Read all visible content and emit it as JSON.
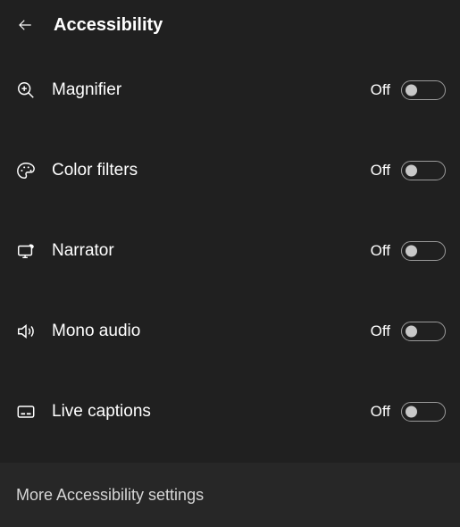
{
  "header": {
    "title": "Accessibility"
  },
  "items": [
    {
      "icon": "magnifier",
      "label": "Magnifier",
      "status": "Off"
    },
    {
      "icon": "color-filters",
      "label": "Color filters",
      "status": "Off"
    },
    {
      "icon": "narrator",
      "label": "Narrator",
      "status": "Off"
    },
    {
      "icon": "mono-audio",
      "label": "Mono audio",
      "status": "Off"
    },
    {
      "icon": "live-captions",
      "label": "Live captions",
      "status": "Off"
    }
  ],
  "footer": {
    "more_label": "More Accessibility settings"
  }
}
